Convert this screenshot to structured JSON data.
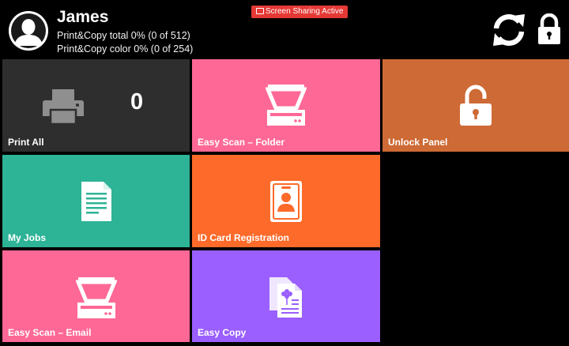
{
  "header": {
    "user_name": "James",
    "quota_total": "Print&Copy total 0% (0 of 512)",
    "quota_color": "Print&Copy color 0% (0 of 254)",
    "screen_sharing_badge": "Screen Sharing Active",
    "icons": [
      "user-avatar-icon",
      "refresh-icon",
      "lock-icon"
    ]
  },
  "tiles": [
    {
      "label": "Print All",
      "icon": "printer-icon",
      "color": "#2e2e2e",
      "count": "0"
    },
    {
      "label": "Easy Scan – Folder",
      "icon": "scanner-icon",
      "color": "#fe6896"
    },
    {
      "label": "Unlock Panel",
      "icon": "unlock-icon",
      "color": "#cd6a35"
    },
    {
      "label": "My Jobs",
      "icon": "document-icon",
      "color": "#2db396"
    },
    {
      "label": "ID Card Registration",
      "icon": "id-card-icon",
      "color": "#fe6a2a"
    },
    {
      "label": "Easy Scan – Email",
      "icon": "scanner-icon",
      "color": "#fe6896"
    },
    {
      "label": "Easy Copy",
      "icon": "copy-icon",
      "color": "#9a5ffe"
    }
  ],
  "colors": {
    "background": "#000000",
    "badge": "#e53935"
  }
}
